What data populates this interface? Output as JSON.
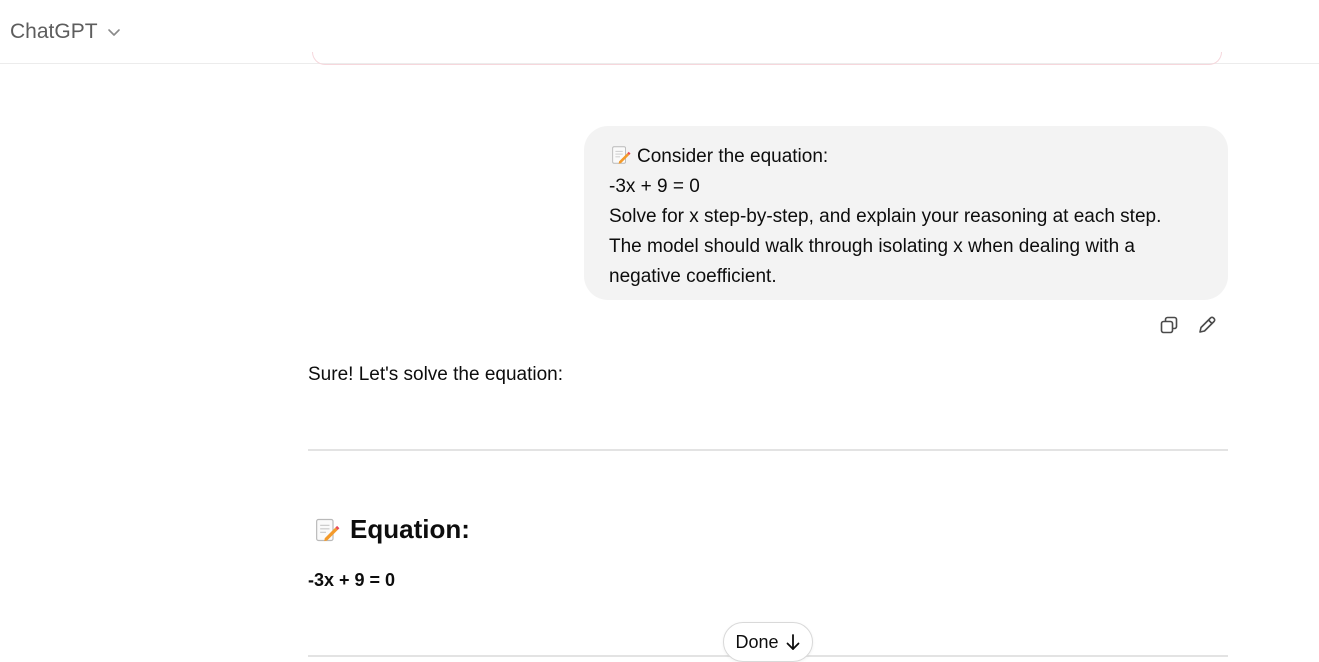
{
  "header": {
    "model_name": "ChatGPT"
  },
  "user_message": {
    "lines": [
      "Consider the equation:",
      "-3x + 9 = 0",
      "Solve for x step-by-step, and explain your reasoning at each step.",
      "The model should walk through isolating x when dealing with a",
      "negative coefficient."
    ]
  },
  "message_actions": {
    "icons": [
      "copy-icon",
      "edit-icon"
    ]
  },
  "assistant": {
    "intro": "Sure! Let's solve the equation:",
    "heading": "Equation:",
    "equation": "-3x + 9 = 0"
  },
  "scroll_button": {
    "label": "Done"
  },
  "colors": {
    "bubble_bg": "#f3f3f3",
    "divider": "#e3e3e3",
    "header_text": "#5d5d5d"
  }
}
